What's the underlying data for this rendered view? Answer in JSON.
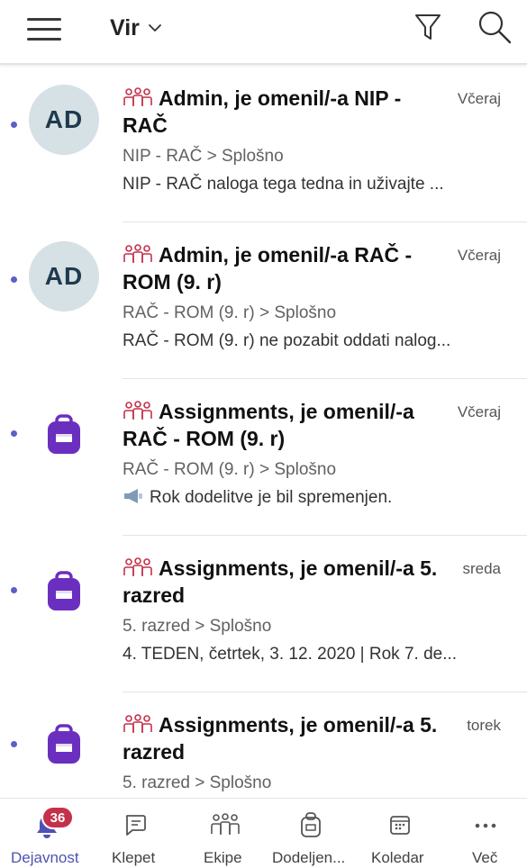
{
  "header": {
    "title": "Vir",
    "icons": [
      "hamburger-menu-icon",
      "chevron-down-icon",
      "filter-icon",
      "search-icon"
    ]
  },
  "colors": {
    "accent": "#4f52b2",
    "unread_dot": "#5b5fc7",
    "badge": "#c4314b",
    "assignments_purple": "#6b2fbf",
    "team_icon": "#c4314b",
    "avatar_bg": "#d5e1e5"
  },
  "feed": [
    {
      "avatar_text": "AD",
      "headline": "Admin, je omenil/-a NIP - RAČ",
      "time": "Včeraj",
      "channel": "NIP - RAČ  > Splošno",
      "preview": "NIP - RAČ naloga tega tedna in uživajte ..."
    },
    {
      "avatar_text": "AD",
      "headline": "Admin, je omenil/-a RAČ - ROM (9. r)",
      "time": "Včeraj",
      "channel": "RAČ - ROM (9. r)  > Splošno",
      "preview": "RAČ - ROM (9. r) ne pozabit oddati nalog..."
    },
    {
      "avatar_icon": "assignments-icon",
      "headline": "Assignments, je omenil/-a RAČ - ROM (9. r)",
      "time": "Včeraj",
      "channel": "RAČ - ROM (9. r)  > Splošno",
      "preview": "Rok dodelitve je bil spremenjen."
    },
    {
      "avatar_icon": "assignments-icon",
      "headline": "Assignments, je omenil/-a 5. razred",
      "time": "sreda",
      "channel": "5. razred  > Splošno",
      "preview": "4. TEDEN, četrtek, 3. 12. 2020 | Rok 7. de..."
    },
    {
      "avatar_icon": "assignments-icon",
      "headline": "Assignments, je omenil/-a 5. razred",
      "time": "torek",
      "channel": "5. razred  > Splošno",
      "preview": ""
    }
  ],
  "bottom_nav": {
    "badge_count": "36",
    "items": [
      {
        "label": "Dejavnost",
        "icon": "bell-icon",
        "active": true
      },
      {
        "label": "Klepet",
        "icon": "chat-icon"
      },
      {
        "label": "Ekipe",
        "icon": "teams-icon"
      },
      {
        "label": "Dodeljen...",
        "icon": "assignments-icon"
      },
      {
        "label": "Koledar",
        "icon": "calendar-icon"
      },
      {
        "label": "Več",
        "icon": "more-icon"
      }
    ]
  }
}
